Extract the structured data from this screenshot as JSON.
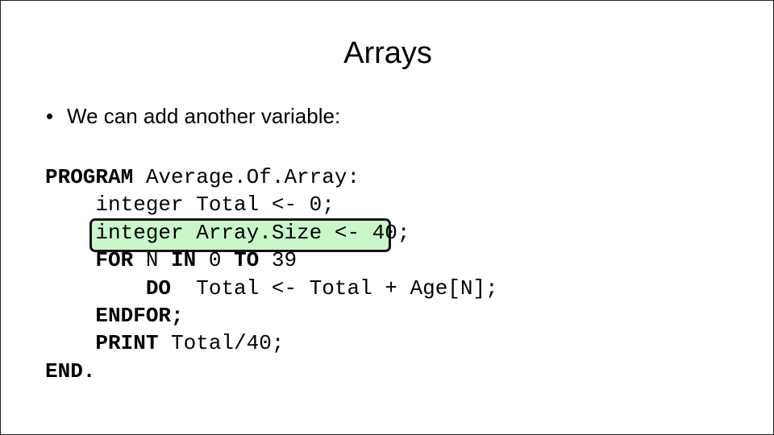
{
  "title": "Arrays",
  "bullet": {
    "marker": "•",
    "text": "We can add another variable:"
  },
  "highlight_color": "#c9f7c9",
  "code": [
    [
      {
        "t": "PROGRAM",
        "b": true
      },
      {
        "t": " Average.Of.Array:",
        "b": false
      }
    ],
    [
      {
        "t": "    integer Total <- 0;",
        "b": false
      }
    ],
    [
      {
        "t": "    integer Array.Size <- 40;",
        "b": false
      }
    ],
    [
      {
        "t": "    ",
        "b": false
      },
      {
        "t": "FOR",
        "b": true
      },
      {
        "t": " N ",
        "b": false
      },
      {
        "t": "IN",
        "b": true
      },
      {
        "t": " 0 ",
        "b": false
      },
      {
        "t": "TO",
        "b": true
      },
      {
        "t": " 39",
        "b": false
      }
    ],
    [
      {
        "t": "        ",
        "b": false
      },
      {
        "t": "DO",
        "b": true
      },
      {
        "t": "  Total <- Total + Age[N];",
        "b": false
      }
    ],
    [
      {
        "t": "    ",
        "b": false
      },
      {
        "t": "ENDFOR;",
        "b": true
      }
    ],
    [
      {
        "t": "    ",
        "b": false
      },
      {
        "t": "PRINT",
        "b": true
      },
      {
        "t": " Total/40;",
        "b": false
      }
    ],
    [
      {
        "t": "END.",
        "b": true
      }
    ]
  ]
}
